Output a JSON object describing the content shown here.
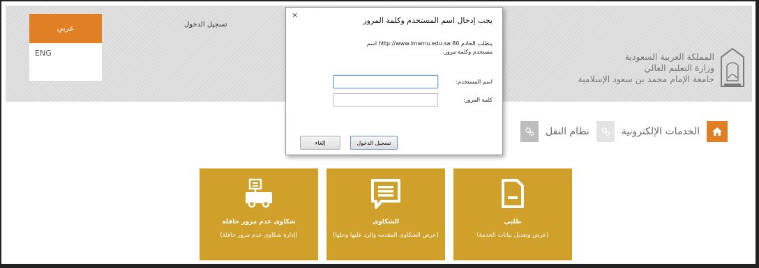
{
  "header": {
    "lang_active": "عربي",
    "lang_eng": "ENG",
    "login_link": "تسجيل الدخول",
    "ministry_lines": [
      "المملكة العربية السعودية",
      "وزارة التعليم العالي",
      "جامعة الإمام محمد بن سعود الإسلامية"
    ]
  },
  "nav": {
    "home_icon": "home-icon",
    "eservices": "الخدمات الإلكترونية",
    "transport": "نظام النقل"
  },
  "tiles": [
    {
      "title": "طلبي",
      "desc": "(عرض وتعديل بيانات الخدمة)",
      "icon": "document-icon"
    },
    {
      "title": "الشكاوى",
      "desc": "(عرض الشكاوى المقدمه والرد عليها وحلها)",
      "icon": "comment-icon"
    },
    {
      "title": "شكاوى عدم مرور حافلة",
      "desc": "(إدارة شكاوى عدم مرور حافلة)",
      "icon": "bus-icon"
    }
  ],
  "dialog": {
    "close": "×",
    "title": "يجب إدخال اسم المستخدم وكلمة المرور",
    "message": "يتطلب الخادم http://www.imamu.edu.sa:80 اسم مستخدم وكلمة مرور.",
    "username_label": "اسم المستخدم:",
    "password_label": "كلمة المرور:",
    "username_value": "",
    "password_value": "",
    "login_button": "تسجيل الدخول",
    "cancel_button": "إلغاء"
  },
  "colors": {
    "accent": "#e07f24",
    "tile": "#cfa02a"
  }
}
